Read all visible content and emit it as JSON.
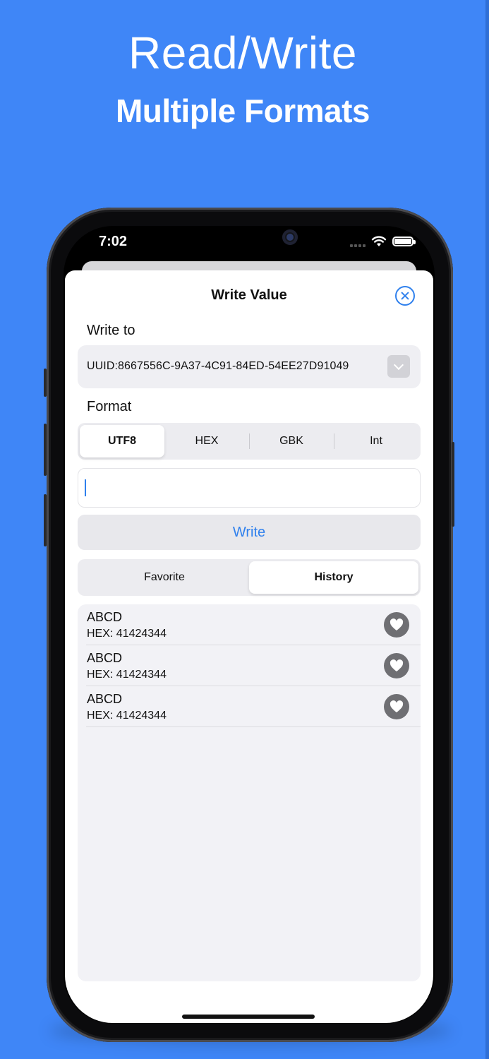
{
  "promo": {
    "title": "Read/Write",
    "subtitle": "Multiple Formats"
  },
  "status_bar": {
    "time": "7:02"
  },
  "sheet": {
    "title": "Write Value",
    "write_to_label": "Write to",
    "target_uuid": "UUID:8667556C-9A37-4C91-84ED-54EE27D91049",
    "format_label": "Format",
    "formats": [
      "UTF8",
      "HEX",
      "GBK",
      "Int"
    ],
    "selected_format": "UTF8",
    "input_value": "",
    "write_button": "Write",
    "list_tabs": [
      "Favorite",
      "History"
    ],
    "selected_list_tab": "History",
    "history": [
      {
        "value": "ABCD",
        "hex": "HEX: 41424344"
      },
      {
        "value": "ABCD",
        "hex": "HEX: 41424344"
      },
      {
        "value": "ABCD",
        "hex": "HEX: 41424344"
      }
    ]
  },
  "icons": {
    "close": "close-circle-icon",
    "dropdown": "chevron-down-icon",
    "favorite": "heart-icon",
    "wifi": "wifi-icon",
    "battery": "battery-icon",
    "signal": "signal-icon"
  },
  "colors": {
    "background": "#3f86f7",
    "accent": "#2f80ed",
    "heart_button": "#6f6f73"
  }
}
